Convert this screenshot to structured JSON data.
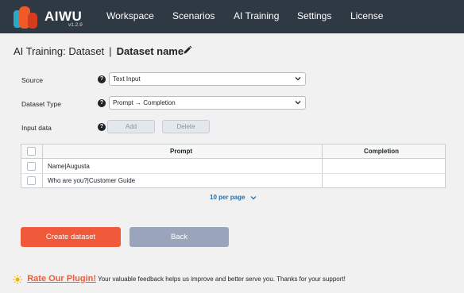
{
  "app": {
    "brand": "AIWU",
    "version": "v1.2.9",
    "nav": [
      "Workspace",
      "Scenarios",
      "AI Training",
      "Settings",
      "License"
    ]
  },
  "title": {
    "section": "AI Training: Dataset",
    "separator": "|",
    "dataset_name": "Dataset name"
  },
  "form": {
    "source": {
      "label": "Source",
      "value": "Text Input"
    },
    "dataset_type": {
      "label": "Dataset Type",
      "value": "Prompt → Completion"
    },
    "input_data": {
      "label": "Input data",
      "add_label": "Add",
      "delete_label": "Delete"
    },
    "help_glyph": "?"
  },
  "table": {
    "columns": [
      "Prompt",
      "Completion"
    ],
    "rows": [
      {
        "prompt": "Name|Augusta",
        "completion": ""
      },
      {
        "prompt": "Who are you?|Customer Guide",
        "completion": ""
      }
    ]
  },
  "pagination": {
    "per_page_label": "10 per page"
  },
  "actions": {
    "create_label": "Create dataset",
    "back_label": "Back"
  },
  "footer": {
    "rate_label": "Rate Our Plugin!",
    "message": "Your valuable feedback helps us improve and better serve you. Thanks for your support!"
  },
  "colors": {
    "header_bg": "#2f3944",
    "accent": "#f05a3b",
    "back_button": "#9aa5bb",
    "link": "#2271b1"
  }
}
